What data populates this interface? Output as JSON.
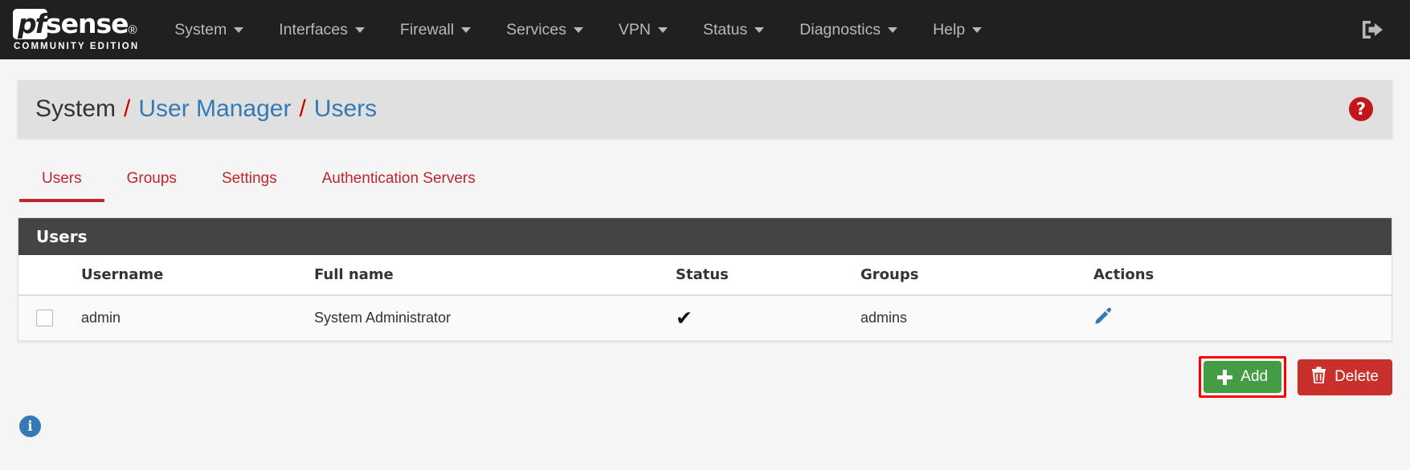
{
  "navbar": {
    "brand": {
      "pf": "pf",
      "sense": "sense",
      "subtitle": "COMMUNITY EDITION"
    },
    "menu": [
      {
        "label": "System"
      },
      {
        "label": "Interfaces"
      },
      {
        "label": "Firewall"
      },
      {
        "label": "Services"
      },
      {
        "label": "VPN"
      },
      {
        "label": "Status"
      },
      {
        "label": "Diagnostics"
      },
      {
        "label": "Help"
      }
    ],
    "logout_icon": "sign-out-icon"
  },
  "breadcrumb": {
    "root": "System",
    "separator": "/",
    "links": [
      "User Manager",
      "Users"
    ],
    "help_icon": "question-circle-icon"
  },
  "tabs": [
    {
      "label": "Users",
      "active": true
    },
    {
      "label": "Groups",
      "active": false
    },
    {
      "label": "Settings",
      "active": false
    },
    {
      "label": "Authentication Servers",
      "active": false
    }
  ],
  "panel": {
    "title": "Users",
    "columns": [
      "",
      "Username",
      "Full name",
      "Status",
      "Groups",
      "Actions"
    ],
    "rows": [
      {
        "checkbox": false,
        "username": "admin",
        "fullname": "System Administrator",
        "status": "✔",
        "groups": "admins",
        "action_icon": "pencil-icon"
      }
    ]
  },
  "buttons": {
    "add": {
      "label": "Add",
      "icon": "plus-icon",
      "color": "#449d44",
      "highlighted": true
    },
    "delete": {
      "label": "Delete",
      "icon": "trash-icon",
      "color": "#c9302c"
    }
  },
  "footer": {
    "info_icon": "info-circle-icon"
  },
  "colors": {
    "navbar_bg": "#202020",
    "accent_red": "#c0262c",
    "link_blue": "#337ab7",
    "panel_heading_bg": "#444444",
    "highlight": "#ff0000"
  }
}
